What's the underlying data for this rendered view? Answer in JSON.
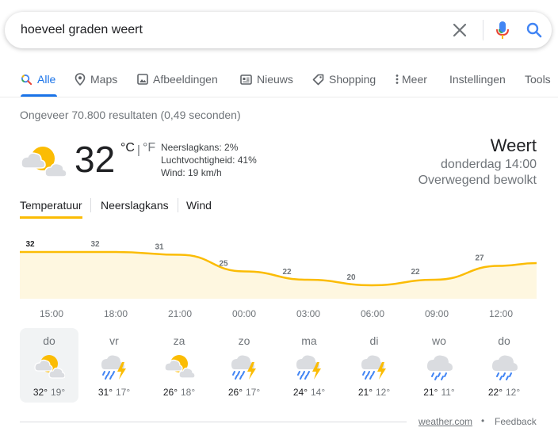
{
  "search": {
    "query": "hoeveel graden weert"
  },
  "tabs": [
    {
      "label": "Alle",
      "icon": "search-icon",
      "active": true
    },
    {
      "label": "Maps",
      "icon": "map-pin-icon"
    },
    {
      "label": "Afbeeldingen",
      "icon": "image-icon"
    },
    {
      "label": "Nieuws",
      "icon": "news-icon"
    },
    {
      "label": "Shopping",
      "icon": "tag-icon"
    },
    {
      "label": "Meer",
      "icon": "more-vert-icon"
    },
    {
      "label": "Instellingen"
    },
    {
      "label": "Tools"
    }
  ],
  "results_stats": "Ongeveer 70.800 resultaten (0,49 seconden)",
  "weather": {
    "temperature": "32",
    "unit_c": "°C",
    "unit_sep": "|",
    "unit_f": "°F",
    "precipitation": "Neerslagkans: 2%",
    "humidity": "Luchtvochtigheid: 41%",
    "wind": "Wind: 19 km/h",
    "location": "Weert",
    "datetime": "donderdag 14:00",
    "condition": "Overwegend bewolkt",
    "current_icon": "partly-cloudy-icon"
  },
  "chart_tabs": [
    "Temperatuur",
    "Neerslagkans",
    "Wind"
  ],
  "chart_data": {
    "type": "area",
    "x": [
      "14:00",
      "15:00",
      "18:00",
      "21:00",
      "00:00",
      "03:00",
      "06:00",
      "09:00",
      "12:00",
      "14:00"
    ],
    "values": [
      32,
      32,
      32,
      31,
      25,
      22,
      20,
      22,
      27,
      28
    ],
    "labels": [
      "32",
      "32",
      "31",
      "25",
      "22",
      "20",
      "22",
      "27"
    ],
    "tick_labels": [
      "15:00",
      "18:00",
      "21:00",
      "00:00",
      "03:00",
      "06:00",
      "09:00",
      "12:00"
    ],
    "ylim": [
      0,
      34
    ],
    "colors": {
      "line": "#fbbc04",
      "fill": "#fef7e0"
    }
  },
  "forecast": [
    {
      "day": "do",
      "high": "32°",
      "low": "19°",
      "icon": "partly-cloudy-icon"
    },
    {
      "day": "vr",
      "high": "31°",
      "low": "17°",
      "icon": "thunderstorm-icon"
    },
    {
      "day": "za",
      "high": "26°",
      "low": "18°",
      "icon": "partly-cloudy-icon"
    },
    {
      "day": "zo",
      "high": "26°",
      "low": "17°",
      "icon": "thunderstorm-icon"
    },
    {
      "day": "ma",
      "high": "24°",
      "low": "14°",
      "icon": "thunderstorm-icon"
    },
    {
      "day": "di",
      "high": "21°",
      "low": "12°",
      "icon": "thunderstorm-icon"
    },
    {
      "day": "wo",
      "high": "21°",
      "low": "11°",
      "icon": "rain-icon"
    },
    {
      "day": "do",
      "high": "22°",
      "low": "12°",
      "icon": "rain-icon"
    }
  ],
  "footer": {
    "source": "weather.com",
    "separator": "•",
    "feedback": "Feedback"
  },
  "colors": {
    "accent": "#1a73e8",
    "sun": "#fbbc04",
    "cloud": "#dadce0",
    "rain": "#4285f4"
  }
}
